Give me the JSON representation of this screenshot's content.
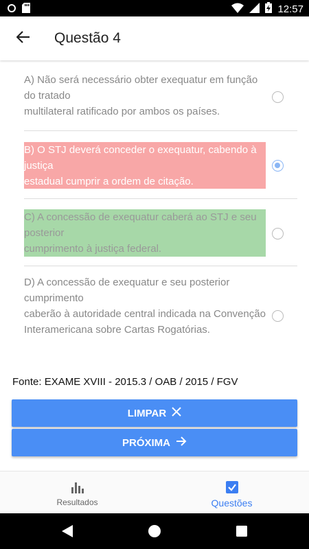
{
  "status_bar": {
    "time": "12:57",
    "icons": [
      "notification-ring-icon",
      "sd-card-icon",
      "wifi-icon",
      "signal-icon",
      "battery-charging-icon"
    ]
  },
  "app_bar": {
    "back_icon": "arrow-left-icon",
    "title": "Questão 4"
  },
  "options": [
    {
      "text": "A) Não será necessário obter exequatur em função do tratado\nmultilateral ratificado por ambos os países.",
      "selected": false,
      "highlight": "none"
    },
    {
      "text": "B) O STJ deverá conceder o exequatur, cabendo à justiça\nestadual cumprir a ordem de citação.",
      "selected": true,
      "highlight": "incorrect"
    },
    {
      "text": "C) A concessão de exequatur caberá ao STJ e seu posterior\ncumprimento à justiça federal.",
      "selected": false,
      "highlight": "correct"
    },
    {
      "text": "D) A concessão de exequatur e seu posterior cumprimento\ncaberão à autoridade central indicada na Convenção\nInteramericana sobre Cartas Rogatórias.",
      "selected": false,
      "highlight": "none"
    }
  ],
  "source": "Fonte: EXAME XVIII - 2015.3 / OAB / 2015 / FGV",
  "buttons": {
    "clear_label": "LIMPAR",
    "clear_icon": "close-icon",
    "next_label": "PRÓXIMA",
    "next_icon": "arrow-right-icon"
  },
  "bottom_nav": {
    "items": [
      {
        "label": "Resultados",
        "icon": "bar-chart-icon",
        "active": false
      },
      {
        "label": "Questões",
        "icon": "checkbox-icon",
        "active": true
      }
    ]
  },
  "colors": {
    "accent": "#4a8ef5",
    "incorrect": "#f8a7a7",
    "correct": "#a7d8a8",
    "active_tab": "#3b7ef2"
  }
}
